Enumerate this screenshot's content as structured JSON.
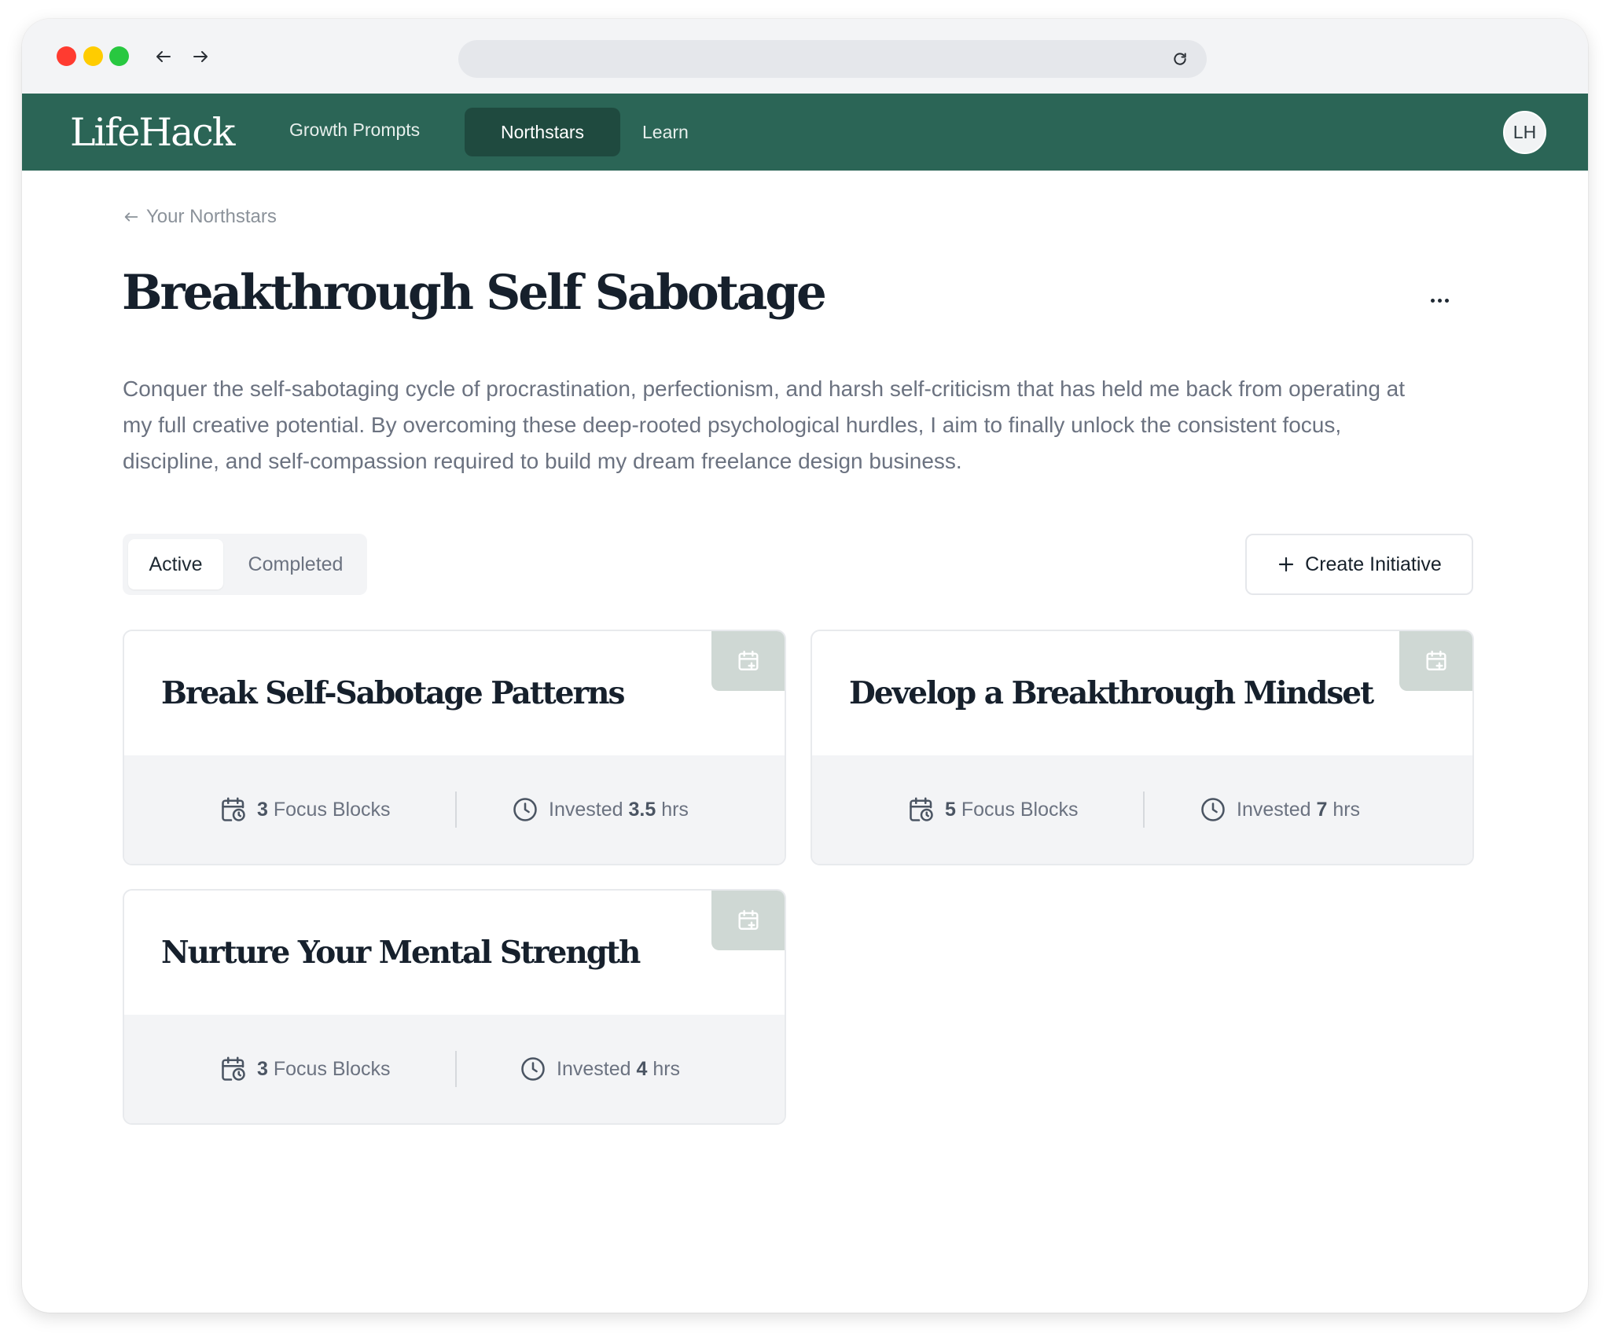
{
  "app": {
    "logo": "LifeHack",
    "avatar_initials": "LH",
    "accent_color": "#2b6556",
    "active_pill_color": "#1f4a3f"
  },
  "nav": {
    "items": [
      {
        "label": "Growth Prompts",
        "active": false
      },
      {
        "label": "Northstars",
        "active": true
      },
      {
        "label": "Learn",
        "active": false
      }
    ]
  },
  "breadcrumb": {
    "label": "Your Northstars",
    "icon": "arrow-left-icon"
  },
  "page": {
    "title": "Breakthrough Self Sabotage",
    "description": "Conquer the self-sabotaging cycle of procrastination, perfectionism, and harsh self-criticism that has held me back from operating at my full creative potential. By overcoming these deep-rooted psychological hurdles, I aim to finally unlock the consistent focus, discipline, and self-compassion required to build my dream freelance design business."
  },
  "tabs": [
    {
      "label": "Active",
      "selected": true
    },
    {
      "label": "Completed",
      "selected": false
    }
  ],
  "actions": {
    "create_label": "Create Initiative"
  },
  "cards": [
    {
      "title": "Break Self-Sabotage Patterns",
      "focus_count": "3",
      "focus_label": "Focus Blocks",
      "invested_prefix": "Invested",
      "invested_value": "3.5",
      "invested_unit": "hrs"
    },
    {
      "title": "Develop a Breakthrough Mindset",
      "focus_count": "5",
      "focus_label": "Focus Blocks",
      "invested_prefix": "Invested",
      "invested_value": "7",
      "invested_unit": "hrs"
    },
    {
      "title": "Nurture Your Mental Strength",
      "focus_count": "3",
      "focus_label": "Focus Blocks",
      "invested_prefix": "Invested",
      "invested_value": "4",
      "invested_unit": "hrs"
    }
  ]
}
